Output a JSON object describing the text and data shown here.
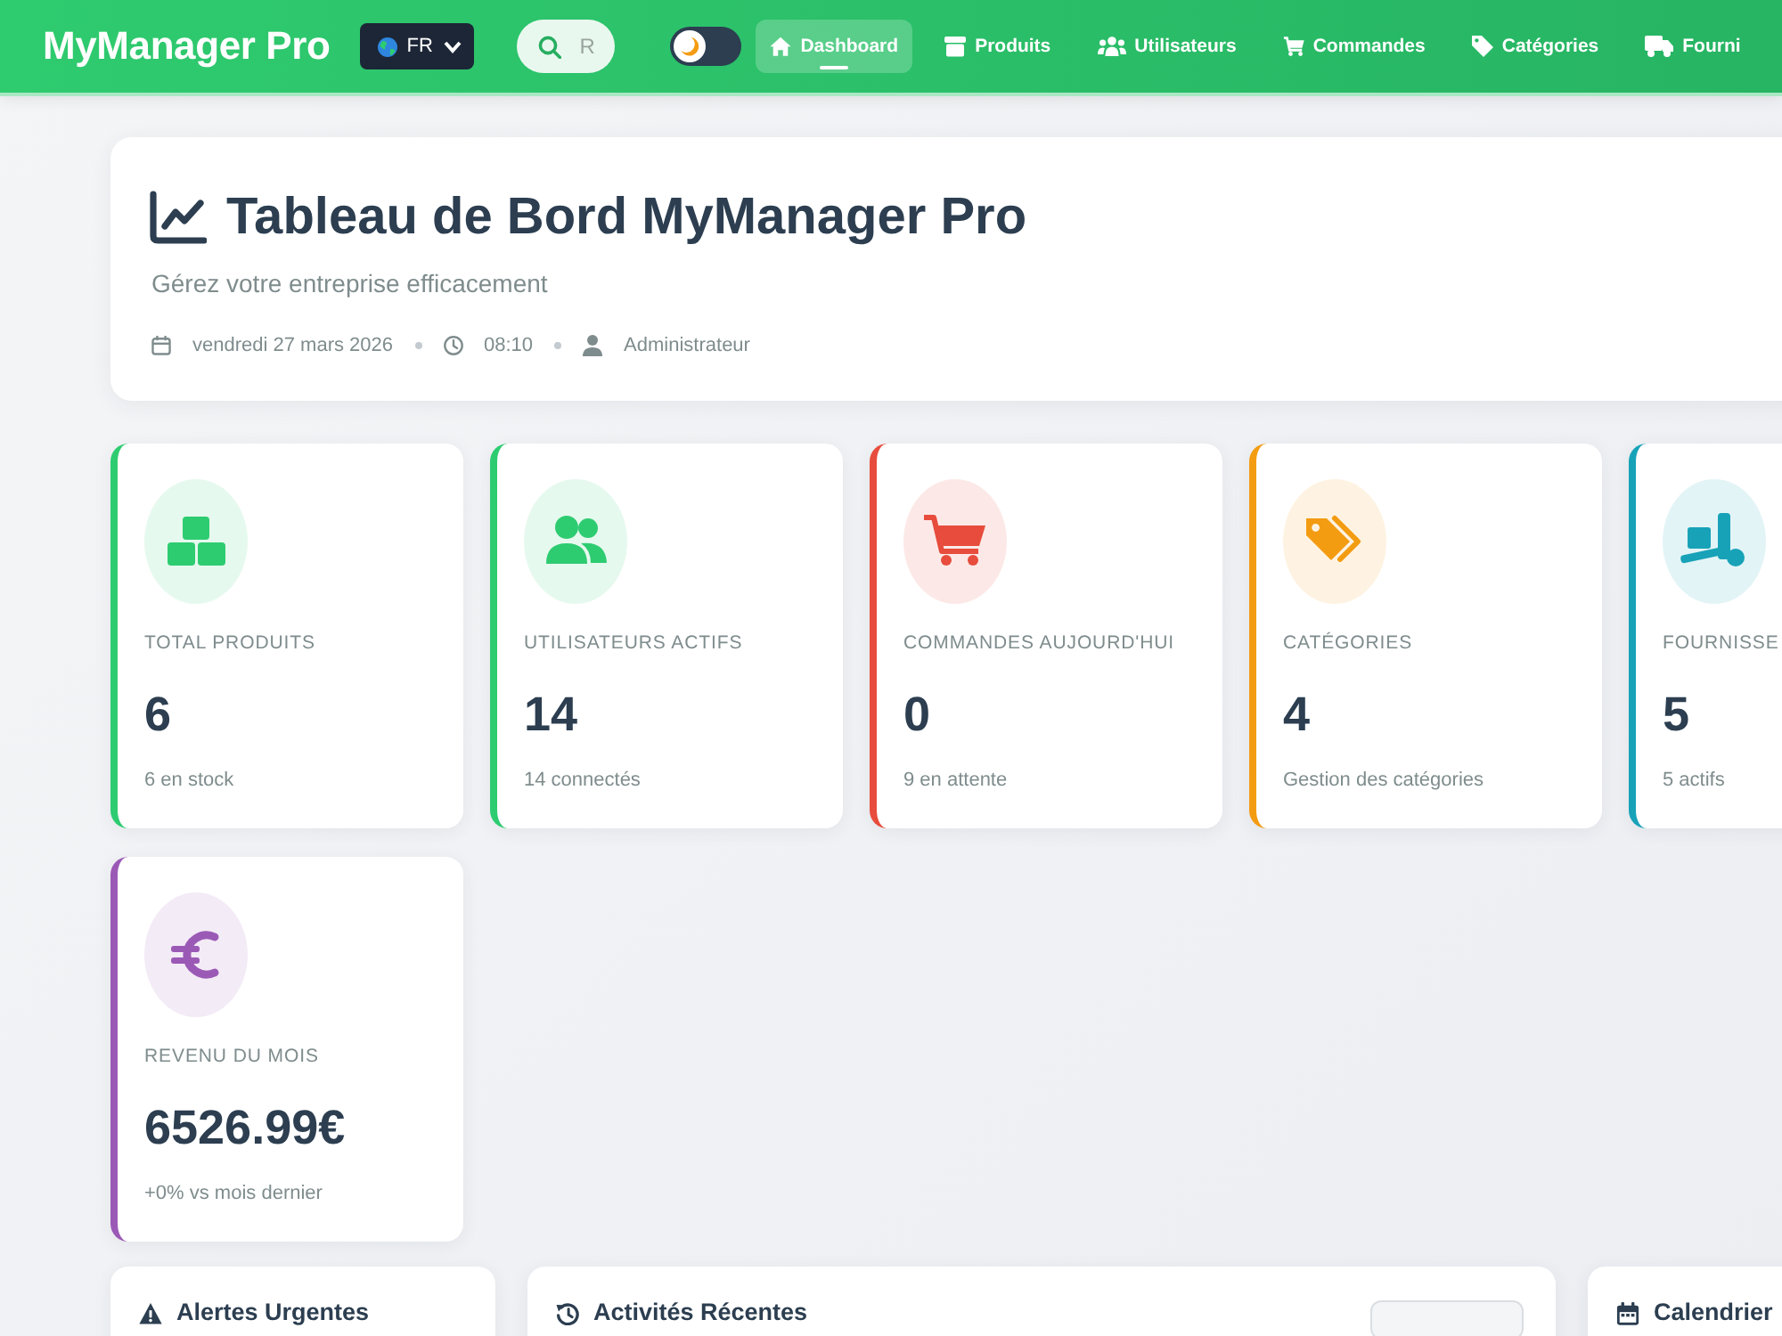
{
  "navbar": {
    "brand": "MyManager Pro",
    "language": "FR",
    "search": {
      "placeholder": "R"
    },
    "theme_toggle": {
      "on": false
    },
    "items": [
      {
        "label": "Dashboard",
        "selected": true
      },
      {
        "label": "Produits",
        "selected": false
      },
      {
        "label": "Utilisateurs",
        "selected": false
      },
      {
        "label": "Commandes",
        "selected": false
      },
      {
        "label": "Catégories",
        "selected": false
      },
      {
        "label": "Fourni",
        "selected": false
      }
    ]
  },
  "header": {
    "title": "Tableau de Bord MyManager Pro",
    "subtitle": "Gérez votre entreprise efficacement",
    "date": "vendredi 27 mars 2026",
    "time": "08:10",
    "user": "Administrateur"
  },
  "stats": [
    {
      "label": "TOTAL PRODUITS",
      "value": "6",
      "note": "6 en stock",
      "color": "#2ecc71"
    },
    {
      "label": "UTILISATEURS ACTIFS",
      "value": "14",
      "note": "14 connectés",
      "color": "#2ecc71"
    },
    {
      "label": "COMMANDES AUJOURD'HUI",
      "value": "0",
      "note": "9 en attente",
      "color": "#e74c3c"
    },
    {
      "label": "CATÉGORIES",
      "value": "4",
      "note": "Gestion des catégories",
      "color": "#f39c12"
    },
    {
      "label": "FOURNISSE",
      "value": "5",
      "note": "5 actifs",
      "color": "#17a2b8"
    },
    {
      "label": "REVENU DU MOIS",
      "value": "6526.99€",
      "note": "+0% vs mois dernier",
      "color": "#9b59b6"
    }
  ],
  "panels": [
    {
      "kind": "alerts",
      "title": "Alertes Urgentes"
    },
    {
      "kind": "activity",
      "title": "Activités Récentes"
    },
    {
      "kind": "calendar",
      "title": "Calendrier"
    }
  ]
}
